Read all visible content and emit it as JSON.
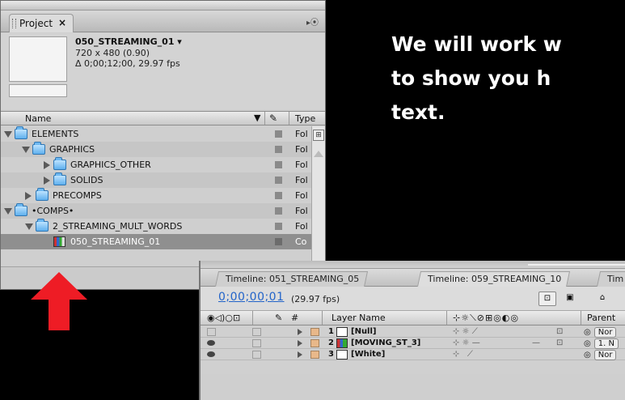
{
  "project_panel": {
    "tab_label": "Project",
    "close_glyph": "×",
    "comp_name": "050_STREAMING_01 ▾",
    "comp_size": "720 x 480 (0.90)",
    "comp_duration": "Δ 0;00;12;00, 29.97 fps",
    "col_name": "Name",
    "col_type": "Type",
    "items": [
      {
        "label": "ELEMENTS",
        "type": "Fol",
        "expanded": true,
        "icon": "folder-icon"
      },
      {
        "label": "GRAPHICS",
        "type": "Fol",
        "expanded": true,
        "icon": "folder-icon"
      },
      {
        "label": "GRAPHICS_OTHER",
        "type": "Fol",
        "expanded": false,
        "icon": "folder-icon"
      },
      {
        "label": "SOLIDS",
        "type": "Fol",
        "expanded": false,
        "icon": "folder-icon"
      },
      {
        "label": "PRECOMPS",
        "type": "Fol",
        "expanded": false,
        "icon": "folder-icon"
      },
      {
        "label": "•COMPS•",
        "type": "Fol",
        "expanded": true,
        "icon": "folder-icon"
      },
      {
        "label": "2_STREAMING_MULT_WORDS",
        "type": "Fol",
        "expanded": true,
        "icon": "folder-icon"
      },
      {
        "label": "050_STREAMING_01",
        "type": "Co",
        "selected": true,
        "icon": "composition-icon"
      }
    ]
  },
  "heading": {
    "line1": "We will work w",
    "line2": "to show you h",
    "line3": "text."
  },
  "timeline_panel": {
    "tabs": [
      "Timeline: 051_STREAMING_05",
      "Timeline: 059_STREAMING_10",
      "Tim"
    ],
    "timecode": "0;00;00;01",
    "fps": "(29.97 fps)",
    "col_hash": "#",
    "col_layer_name": "Layer Name",
    "col_parent": "Parent",
    "layers": [
      {
        "num": "1",
        "name": "[Null]",
        "parent": "Nor",
        "visible": false
      },
      {
        "num": "2",
        "name": "[MOVING_ST_3]",
        "parent": "1. N",
        "visible": true
      },
      {
        "num": "3",
        "name": "[White]",
        "parent": "Nor",
        "visible": true
      }
    ]
  },
  "colors": {
    "arrow": "#ee1c25",
    "timecode": "#2364c9",
    "panel_bg": "#cfcfcf",
    "selected_row": "#8f8f8f"
  }
}
